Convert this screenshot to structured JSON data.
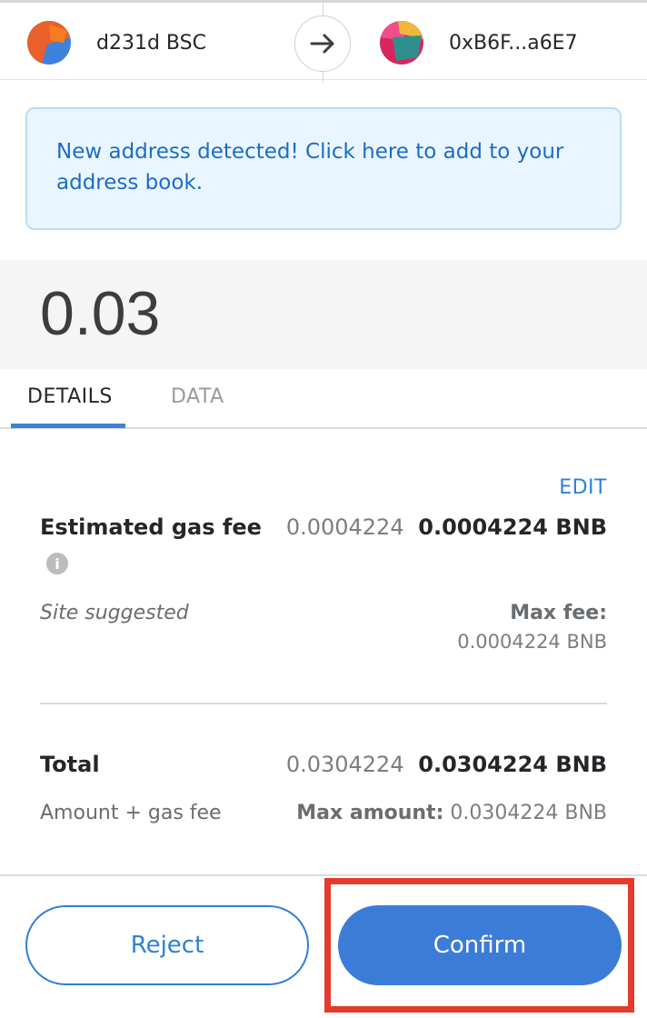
{
  "header": {
    "from_account": "d231d BSC",
    "to_account": "0xB6F...a6E7",
    "icons": {
      "arrow": "arrow-right-icon"
    }
  },
  "banner": {
    "text": "New address detected! Click here to add to your address book."
  },
  "amount": "0.03",
  "tabs": [
    {
      "label": "DETAILS",
      "active": true
    },
    {
      "label": "DATA",
      "active": false
    }
  ],
  "details": {
    "edit_label": "EDIT",
    "gas_fee": {
      "label": "Estimated gas fee",
      "value_light": "0.0004224",
      "value_bold": "0.0004224 BNB",
      "sublabel": "Site suggested",
      "max_fee_label": "Max fee:",
      "max_fee_value": "0.0004224 BNB"
    },
    "total": {
      "label": "Total",
      "value_light": "0.0304224",
      "value_bold": "0.0304224 BNB",
      "sublabel": "Amount + gas fee",
      "max_amount_label": "Max amount:",
      "max_amount_value": "0.0304224 BNB"
    }
  },
  "footer": {
    "reject_label": "Reject",
    "confirm_label": "Confirm"
  },
  "colors": {
    "accent": "#3b7dd6",
    "highlight": "#e33b2e",
    "banner_bg": "#eaf6ff"
  }
}
